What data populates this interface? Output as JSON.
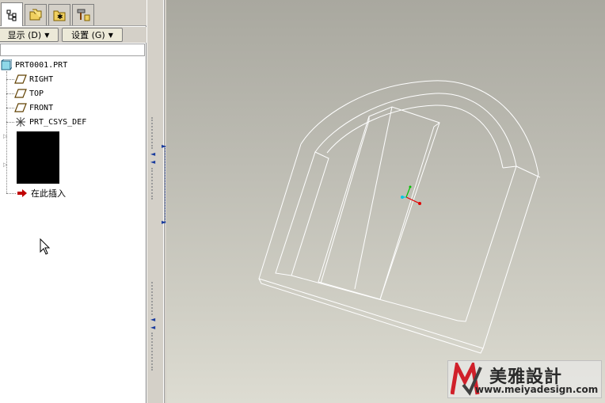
{
  "tabs": [
    {
      "name": "model-tree",
      "icon": "model-tree-icon"
    },
    {
      "name": "folder-browser",
      "icon": "folder-browser-icon"
    },
    {
      "name": "favorites",
      "icon": "favorites-icon"
    },
    {
      "name": "connections",
      "icon": "connections-icon"
    }
  ],
  "toolbar": {
    "show_label": "显示 (D)",
    "settings_label": "设置 (G)"
  },
  "tree": {
    "root": "PRT0001.PRT",
    "items": [
      {
        "label": "RIGHT",
        "icon": "datum-plane-icon"
      },
      {
        "label": "TOP",
        "icon": "datum-plane-icon"
      },
      {
        "label": "FRONT",
        "icon": "datum-plane-icon"
      },
      {
        "label": "PRT_CSYS_DEF",
        "icon": "coordinate-system-icon"
      }
    ],
    "insert_here": "在此插入"
  },
  "watermark": {
    "brand": "美雅設計",
    "url": "www.meiyadesign.com"
  },
  "colors": {
    "panel_bg": "#d4d0c8",
    "tree_bg": "#ffffff",
    "viewport_top": "#a9a89f",
    "viewport_bottom": "#dddcd2",
    "insert_arrow": "#c00000",
    "csys_x": "#e00000",
    "csys_y": "#00c000",
    "csys_z": "#00c8e0",
    "watermark_red": "#d0202a"
  }
}
